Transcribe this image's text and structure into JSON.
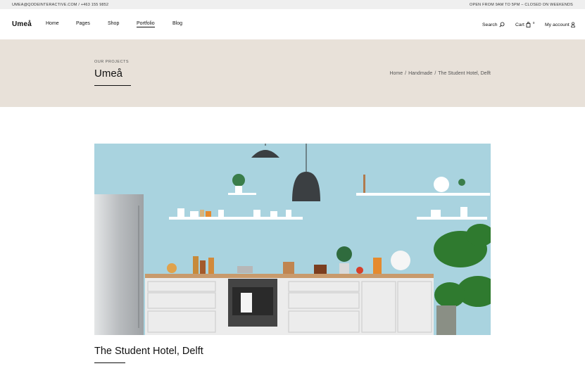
{
  "topbar": {
    "contact": "UMEA@QODEINTERACTIVE.COM / +463 155 9852",
    "hours": "OPEN FROM 9AM TO 5PM – CLOSED ON WEEKENDS"
  },
  "header": {
    "logo": "Umeå",
    "nav": [
      {
        "label": "Home"
      },
      {
        "label": "Pages"
      },
      {
        "label": "Shop"
      },
      {
        "label": "Portfolio",
        "active": true
      },
      {
        "label": "Blog"
      }
    ],
    "search_label": "Search",
    "cart_label": "Cart",
    "cart_count": "0",
    "account_label": "My account"
  },
  "title_band": {
    "eyebrow": "OUR PROJECTS",
    "title": "Umeå",
    "breadcrumb": [
      "Home",
      "Handmade",
      "The Student Hotel, Delft"
    ],
    "separator": "/"
  },
  "content": {
    "project_title": "The Student Hotel, Delft"
  },
  "colors": {
    "topbar_bg": "#efefef",
    "band_bg": "#e8e1d9",
    "wall": "#a9d3df",
    "cabinet": "#f0f0f0",
    "countertop": "#c89a6c"
  }
}
